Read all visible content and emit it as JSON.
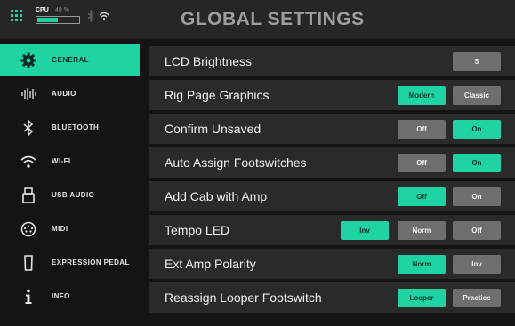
{
  "status_bar": {
    "cpu_label": "CPU",
    "cpu_percent_text": "49 %",
    "cpu_load_fraction": 0.49,
    "icons": [
      "grid-menu-icon",
      "bluetooth-icon",
      "wifi-icon"
    ]
  },
  "page": {
    "title": "GLOBAL SETTINGS"
  },
  "sidebar": {
    "items": [
      {
        "label": "GENERAL",
        "icon": "gear-icon",
        "active": true
      },
      {
        "label": "AUDIO",
        "icon": "audio-waveform-icon",
        "active": false
      },
      {
        "label": "BLUETOOTH",
        "icon": "bluetooth-icon",
        "active": false
      },
      {
        "label": "WI-FI",
        "icon": "wifi-icon",
        "active": false
      },
      {
        "label": "USB AUDIO",
        "icon": "usb-icon",
        "active": false
      },
      {
        "label": "MIDI",
        "icon": "midi-connector-icon",
        "active": false
      },
      {
        "label": "EXPRESSION PEDAL",
        "icon": "expression-pedal-icon",
        "active": false
      },
      {
        "label": "INFO",
        "icon": "info-icon",
        "active": false
      }
    ]
  },
  "settings": [
    {
      "label": "LCD Brightness",
      "options": [
        {
          "label": "5",
          "selected": false
        }
      ]
    },
    {
      "label": "Rig Page Graphics",
      "options": [
        {
          "label": "Modern",
          "selected": true
        },
        {
          "label": "Classic",
          "selected": false
        }
      ]
    },
    {
      "label": "Confirm Unsaved",
      "options": [
        {
          "label": "Off",
          "selected": false
        },
        {
          "label": "On",
          "selected": true
        }
      ]
    },
    {
      "label": "Auto Assign Footswitches",
      "options": [
        {
          "label": "Off",
          "selected": false
        },
        {
          "label": "On",
          "selected": true
        }
      ]
    },
    {
      "label": "Add Cab with Amp",
      "options": [
        {
          "label": "Off",
          "selected": true
        },
        {
          "label": "On",
          "selected": false
        }
      ]
    },
    {
      "label": "Tempo LED",
      "options": [
        {
          "label": "Inv",
          "selected": true
        },
        {
          "label": "Norm",
          "selected": false
        },
        {
          "label": "Off",
          "selected": false
        }
      ]
    },
    {
      "label": "Ext Amp Polarity",
      "options": [
        {
          "label": "Norm",
          "selected": true
        },
        {
          "label": "Inv",
          "selected": false
        }
      ]
    },
    {
      "label": "Reassign Looper Footswitch",
      "options": [
        {
          "label": "Looper",
          "selected": true
        },
        {
          "label": "Practice",
          "selected": false
        }
      ]
    }
  ],
  "colors": {
    "accent": "#1fd3a3",
    "button": "#6e6e6e",
    "row": "#2a2a2a",
    "background": "#141414"
  }
}
